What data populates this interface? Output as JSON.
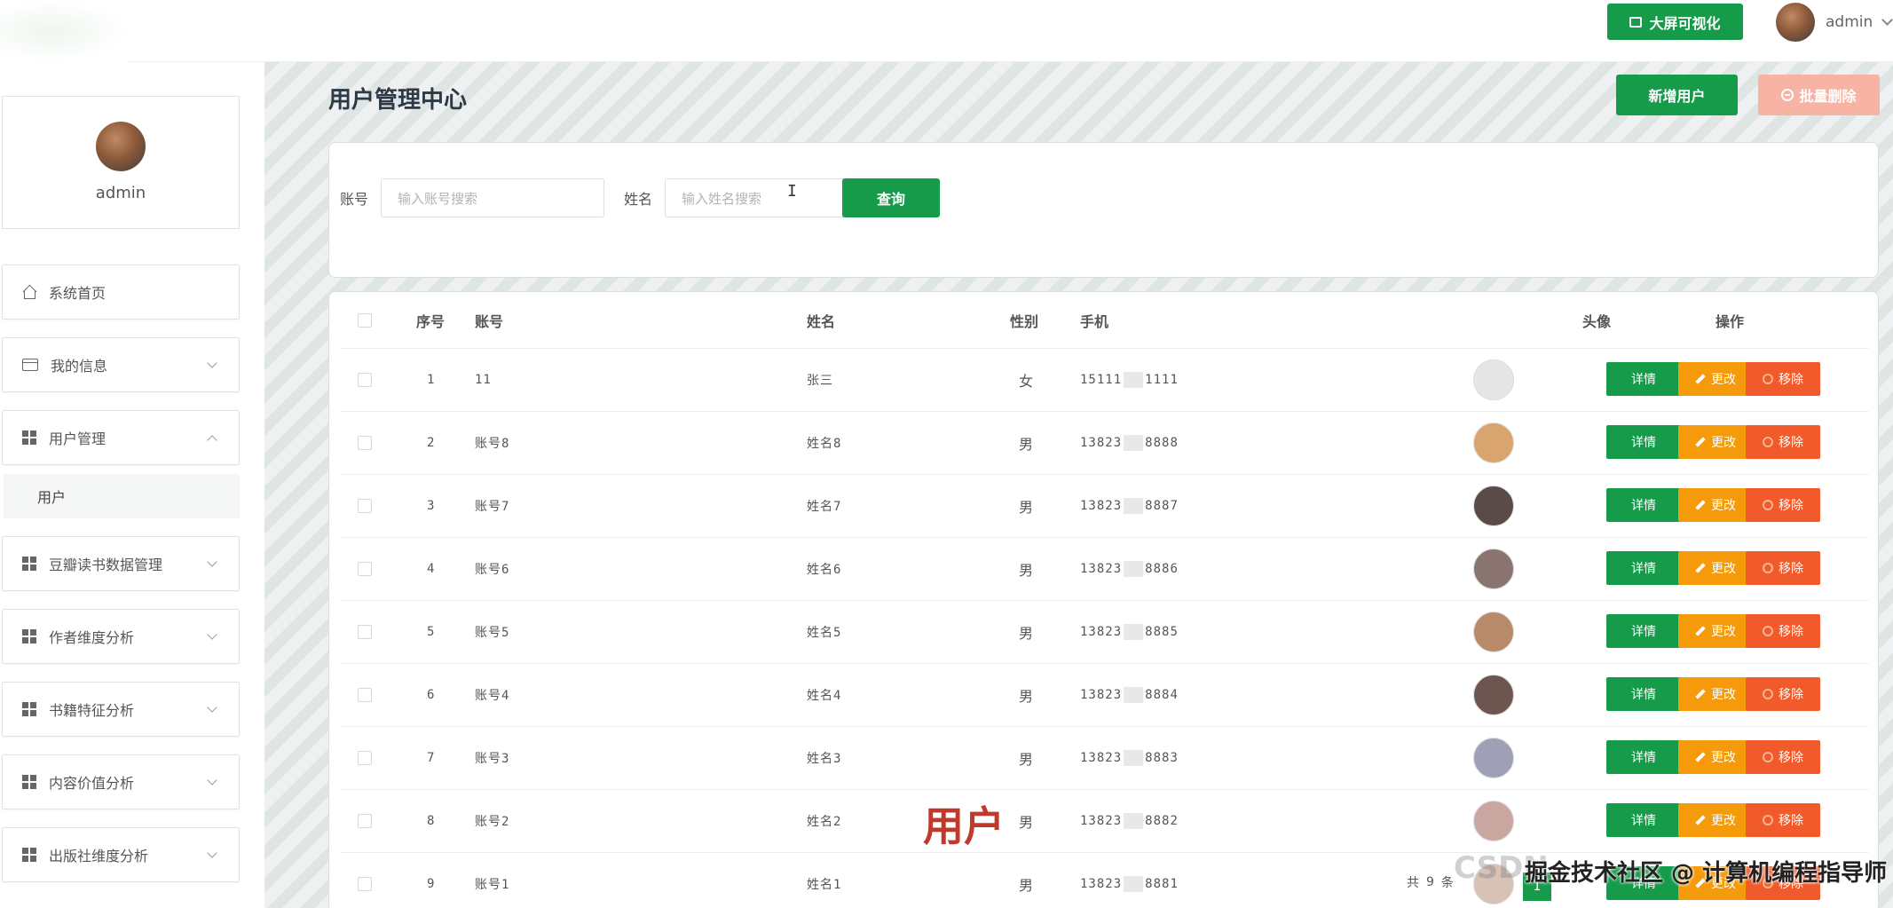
{
  "header": {
    "screen_button": "大屏可视化",
    "username": "admin"
  },
  "sidebar": {
    "profile_name": "admin",
    "items": [
      {
        "label": "系统首页",
        "icon": "home-icon"
      },
      {
        "label": "我的信息",
        "icon": "card-icon"
      },
      {
        "label": "用户管理",
        "icon": "grid-icon"
      },
      {
        "label": "豆瓣读书数据管理",
        "icon": "grid-icon"
      },
      {
        "label": "作者维度分析",
        "icon": "grid-icon"
      },
      {
        "label": "书籍特征分析",
        "icon": "grid-icon"
      },
      {
        "label": "内容价值分析",
        "icon": "grid-icon"
      },
      {
        "label": "出版社维度分析",
        "icon": "grid-icon"
      }
    ],
    "submenu_label": "用户"
  },
  "main": {
    "title": "用户管理中心",
    "add_button": "新增用户",
    "batch_delete_button": "批量删除",
    "search": {
      "account_label": "账号",
      "account_placeholder": "输入账号搜索",
      "name_label": "姓名",
      "name_placeholder": "输入姓名搜索",
      "query_button": "查询"
    },
    "table": {
      "headers": {
        "index": "序号",
        "account": "账号",
        "name": "姓名",
        "gender": "性别",
        "phone": "手机",
        "avatar": "头像",
        "actions": "操作"
      },
      "rows": [
        {
          "index": "1",
          "account": "11",
          "name": "张三",
          "gender": "女",
          "phone_a": "15111",
          "phone_b": "1111",
          "avatar_color": "#e6e6e6"
        },
        {
          "index": "2",
          "account": "账号8",
          "name": "姓名8",
          "gender": "男",
          "phone_a": "13823",
          "phone_b": "8888",
          "avatar_color": "#d9a46d"
        },
        {
          "index": "3",
          "account": "账号7",
          "name": "姓名7",
          "gender": "男",
          "phone_a": "13823",
          "phone_b": "8887",
          "avatar_color": "#5a4a48"
        },
        {
          "index": "4",
          "account": "账号6",
          "name": "姓名6",
          "gender": "男",
          "phone_a": "13823",
          "phone_b": "8886",
          "avatar_color": "#8a7470"
        },
        {
          "index": "5",
          "account": "账号5",
          "name": "姓名5",
          "gender": "男",
          "phone_a": "13823",
          "phone_b": "8885",
          "avatar_color": "#b88a6a"
        },
        {
          "index": "6",
          "account": "账号4",
          "name": "姓名4",
          "gender": "男",
          "phone_a": "13823",
          "phone_b": "8884",
          "avatar_color": "#6d5550"
        },
        {
          "index": "7",
          "account": "账号3",
          "name": "姓名3",
          "gender": "男",
          "phone_a": "13823",
          "phone_b": "8883",
          "avatar_color": "#9fa0b8"
        },
        {
          "index": "8",
          "account": "账号2",
          "name": "姓名2",
          "gender": "男",
          "phone_a": "13823",
          "phone_b": "8882",
          "avatar_color": "#c9a7a0"
        },
        {
          "index": "9",
          "account": "账号1",
          "name": "姓名1",
          "gender": "男",
          "phone_a": "13823",
          "phone_b": "8881",
          "avatar_color": "#d8c2b5"
        }
      ],
      "action_labels": {
        "detail": "详情",
        "edit": "更改",
        "delete": "移除"
      }
    },
    "overlay_label": "用户",
    "pager": {
      "total_prefix": "共",
      "total": "9",
      "total_suffix": "条",
      "current_page": "1"
    },
    "watermark": "掘金技术社区 @ 计算机编程指导师",
    "watermark_bg": "CSDN"
  },
  "colors": {
    "primary": "#169b4b",
    "warning": "#f59b0b",
    "danger": "#f15a2b",
    "danger_light": "#f7b3a3"
  }
}
